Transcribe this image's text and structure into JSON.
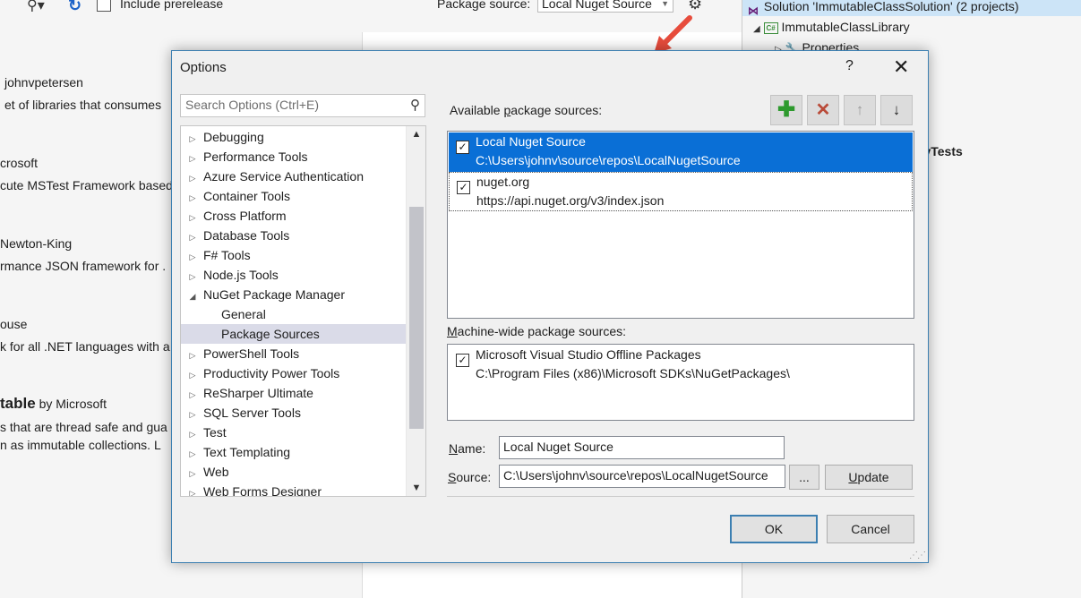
{
  "background": {
    "include_prerelease": "Include prerelease",
    "package_source_label": "Package source:",
    "package_source_value": "Local Nuget Source",
    "packages": [
      {
        "line1": "johnvpetersen",
        "line2": "et of libraries that consumes"
      },
      {
        "line1": "crosoft",
        "line2": "cute MSTest Framework based"
      },
      {
        "line1": "Newton-King",
        "line2": "rmance JSON framework for ."
      },
      {
        "line1": "ouse",
        "line2": "k for all .NET languages with a"
      },
      {
        "title": "table",
        "by": "by Microsoft",
        "line2": "s that are thread safe and gua",
        "line3": "n as immutable collections. L"
      }
    ],
    "solution_explorer": {
      "solution": "Solution 'ImmutableClassSolution' (2 projects)",
      "project": "ImmutableClassLibrary",
      "properties": "Properties",
      "tests_fragment": "ryTests"
    }
  },
  "dialog": {
    "title": "Options",
    "help": "?",
    "close": "✕",
    "search_placeholder": "Search Options (Ctrl+E)",
    "tree": [
      {
        "label": "Debugging",
        "expander": "▷",
        "indent": 0
      },
      {
        "label": "Performance Tools",
        "expander": "▷",
        "indent": 0
      },
      {
        "label": "Azure Service Authentication",
        "expander": "▷",
        "indent": 0
      },
      {
        "label": "Container Tools",
        "expander": "▷",
        "indent": 0
      },
      {
        "label": "Cross Platform",
        "expander": "▷",
        "indent": 0
      },
      {
        "label": "Database Tools",
        "expander": "▷",
        "indent": 0
      },
      {
        "label": "F# Tools",
        "expander": "▷",
        "indent": 0
      },
      {
        "label": "Node.js Tools",
        "expander": "▷",
        "indent": 0
      },
      {
        "label": "NuGet Package Manager",
        "expander": "◢",
        "indent": 0
      },
      {
        "label": "General",
        "expander": "",
        "indent": 1
      },
      {
        "label": "Package Sources",
        "expander": "",
        "indent": 1,
        "selected": true
      },
      {
        "label": "PowerShell Tools",
        "expander": "▷",
        "indent": 0
      },
      {
        "label": "Productivity Power Tools",
        "expander": "▷",
        "indent": 0
      },
      {
        "label": "ReSharper Ultimate",
        "expander": "▷",
        "indent": 0
      },
      {
        "label": "SQL Server Tools",
        "expander": "▷",
        "indent": 0
      },
      {
        "label": "Test",
        "expander": "▷",
        "indent": 0
      },
      {
        "label": "Text Templating",
        "expander": "▷",
        "indent": 0
      },
      {
        "label": "Web",
        "expander": "▷",
        "indent": 0
      },
      {
        "label": "Web Forms Designer",
        "expander": "▷",
        "indent": 0
      }
    ],
    "available_label_pre": "Available ",
    "available_label_u": "p",
    "available_label_post": "ackage sources:",
    "available_sources": [
      {
        "name": "Local Nuget Source",
        "path": "C:\\Users\\johnv\\source\\repos\\LocalNugetSource",
        "checked": true,
        "selected": true
      },
      {
        "name": "nuget.org",
        "path": "https://api.nuget.org/v3/index.json",
        "checked": true,
        "selected": false
      }
    ],
    "machine_label_u": "M",
    "machine_label_post": "achine-wide package sources:",
    "machine_sources": [
      {
        "name": "Microsoft Visual Studio Offline Packages",
        "path": "C:\\Program Files (x86)\\Microsoft SDKs\\NuGetPackages\\",
        "checked": true
      }
    ],
    "name_label_u": "N",
    "name_label_post": "ame:",
    "name_value": "Local Nuget Source",
    "source_label_u": "S",
    "source_label_post": "ource:",
    "source_value": "C:\\Users\\johnv\\source\\repos\\LocalNugetSource",
    "browse_label": "...",
    "update_label_u": "U",
    "update_label_post": "pdate",
    "ok_label": "OK",
    "cancel_label": "Cancel",
    "check_mark": "✓",
    "tool_icons": {
      "add": "✚",
      "remove": "✕",
      "up": "🡑",
      "down": "🡓"
    }
  },
  "colors": {
    "selection_blue": "#0a6fd6",
    "dialog_border": "#3c7fb1",
    "tree_selected": "#dadbe8",
    "arrow_red": "#e74c3c"
  }
}
